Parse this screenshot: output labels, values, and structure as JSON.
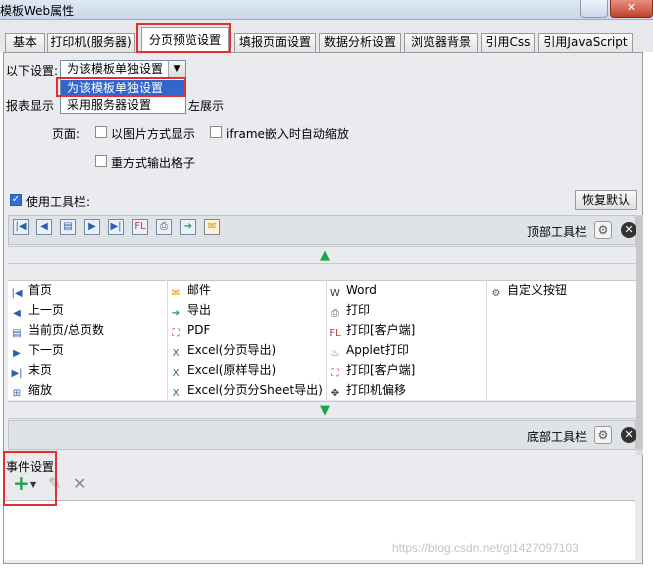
{
  "window": {
    "title": "模板Web属性",
    "close_label": "✕",
    "min_label": "?"
  },
  "tabs": [
    "基本",
    "打印机(服务器)",
    "分页预览设置",
    "填报页面设置",
    "数据分析设置",
    "浏览器背景",
    "引用Css",
    "引用JavaScript"
  ],
  "settings": {
    "label": "以下设置:",
    "selected": "为该模板单独设置",
    "options": [
      "为该模板单独设置",
      "采用服务器设置"
    ],
    "report_display_prefix": "报表显示",
    "report_display_suffix": "左展示",
    "page_label": "页面:",
    "cb_image": "以图片方式显示",
    "cb_iframe": "iframe嵌入时自动缩放",
    "cb_repeat": "重方式输出格子"
  },
  "toolbar": {
    "use_label": "使用工具栏:",
    "restore_label": "恢复默认",
    "top_label": "顶部工具栏",
    "bottom_label": "底部工具栏",
    "top_buttons": [
      "first-page",
      "prev-page",
      "page-number",
      "next-page",
      "last-page",
      "flashprint",
      "print",
      "export",
      "email"
    ]
  },
  "items": [
    [
      "首页",
      "邮件",
      "Word",
      "自定义按钮"
    ],
    [
      "上一页",
      "导出",
      "打印",
      ""
    ],
    [
      "当前页/总页数",
      "PDF",
      "打印[客户端]",
      ""
    ],
    [
      "下一页",
      "Excel(分页导出)",
      "Applet打印",
      ""
    ],
    [
      "末页",
      "Excel(原样导出)",
      "打印[客户端]",
      ""
    ],
    [
      "缩放",
      "Excel(分页分Sheet导出)",
      "打印机偏移",
      ""
    ]
  ],
  "events": {
    "label": "事件设置"
  },
  "watermark": "https://blog.csdn.net/gl1427097103",
  "colors": {
    "highlight": "#e03030",
    "accent": "#1ea34a",
    "selected": "#3366cc"
  }
}
